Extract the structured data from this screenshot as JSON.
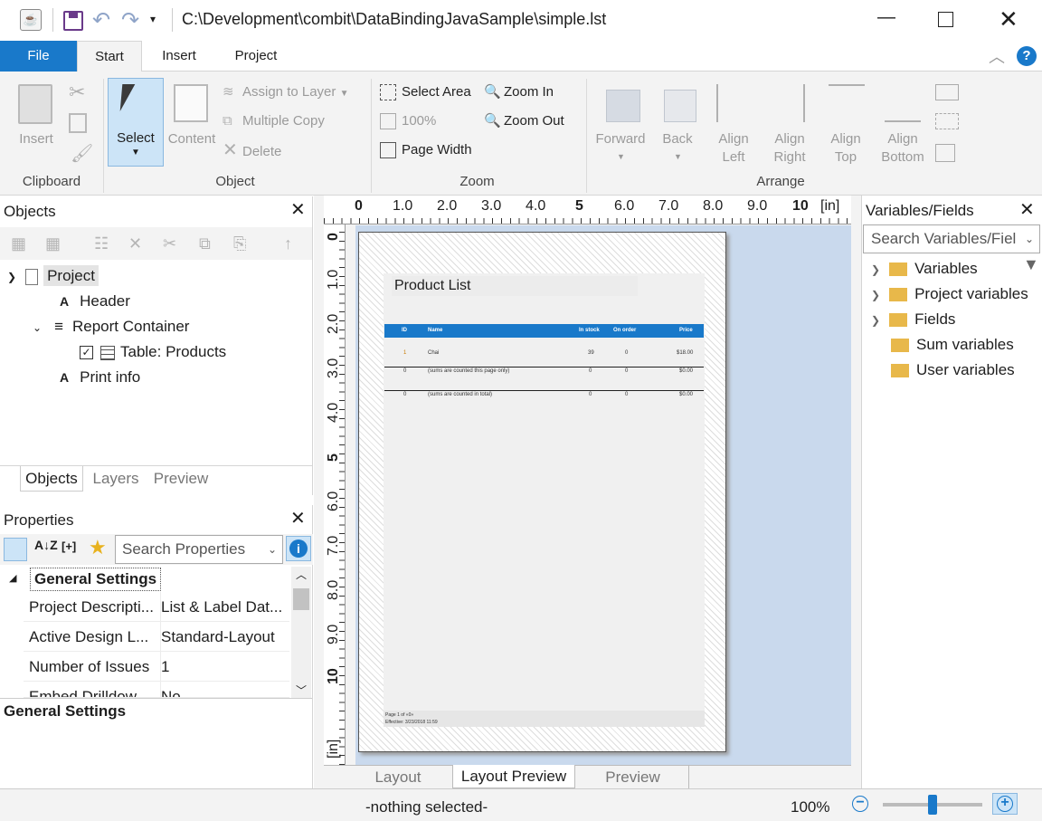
{
  "window": {
    "path": "C:\\Development\\combit\\DataBindingJavaSample\\simple.lst"
  },
  "menu_tabs": [
    "File",
    "Start",
    "Insert",
    "Project"
  ],
  "ribbon": {
    "clipboard": {
      "insert": "Insert",
      "group": "Clipboard"
    },
    "object": {
      "select": "Select",
      "content": "Content",
      "assign_to_layer": "Assign to Layer",
      "multiple_copy": "Multiple Copy",
      "delete": "Delete",
      "group": "Object"
    },
    "zoom": {
      "select_area": "Select Area",
      "zoom_in": "Zoom In",
      "percent": "100%",
      "zoom_out": "Zoom Out",
      "page_width": "Page Width",
      "group": "Zoom"
    },
    "arrange": {
      "forward": "Forward",
      "back": "Back",
      "align_left_1": "Align",
      "align_left_2": "Left",
      "align_right_1": "Align",
      "align_right_2": "Right",
      "align_top_1": "Align",
      "align_top_2": "Top",
      "align_bottom_1": "Align",
      "align_bottom_2": "Bottom",
      "group": "Arrange"
    }
  },
  "objects_panel": {
    "title": "Objects",
    "tree": [
      "Project",
      "Header",
      "Report Container",
      "Table: Products",
      "Print info"
    ],
    "tabs": [
      "Objects",
      "Layers",
      "Preview"
    ]
  },
  "properties_panel": {
    "title": "Properties",
    "search_placeholder": "Search Properties",
    "section": "General Settings",
    "rows": [
      {
        "key": "Project Descripti...",
        "value": "List & Label Dat..."
      },
      {
        "key": "Active Design L...",
        "value": "Standard-Layout"
      },
      {
        "key": "Number of Issues",
        "value": "1"
      },
      {
        "key": "Embed Drilldow...",
        "value": "No"
      }
    ],
    "footer": "General Settings"
  },
  "ruler": {
    "top": [
      "0",
      "1.0",
      "2.0",
      "3.0",
      "4.0",
      "5",
      "6.0",
      "7.0",
      "8.0",
      "9.0",
      "10",
      "[in]"
    ],
    "left": [
      "0",
      "1.0",
      "2.0",
      "3.0",
      "4.0",
      "5",
      "6.0",
      "7.0",
      "8.0",
      "9.0",
      "10",
      "[in]"
    ]
  },
  "page": {
    "title": "Product List",
    "table_header": [
      "ID",
      "Name",
      "In stock",
      "On order",
      "Price"
    ],
    "row1": [
      "1",
      "Chai",
      "39",
      "0",
      "$18.00"
    ],
    "sum1": [
      "0",
      "(sums are counted this page only)",
      "0",
      "0",
      "$0.00"
    ],
    "sum2": [
      "0",
      "(sums are counted in total)",
      "0",
      "0",
      "$0.00"
    ],
    "footer1": "Page 1 of «0»",
    "footer2": "Effective: 3/23/2018 11:59"
  },
  "view_tabs": [
    "Layout",
    "Layout Preview",
    "Preview"
  ],
  "variables_panel": {
    "title": "Variables/Fields",
    "search_placeholder": "Search Variables/Fiel",
    "items": [
      "Variables",
      "Project variables",
      "Fields",
      "Sum variables",
      "User variables"
    ]
  },
  "status": {
    "selection": "-nothing selected-",
    "zoom": "100%",
    "zoom_slider": 0.55
  },
  "colors": {
    "file_tab": "#1979ca",
    "table_header": "#1979ca",
    "canvas_bg": "#c9d9ed",
    "select_btn": "#cce4f7"
  }
}
